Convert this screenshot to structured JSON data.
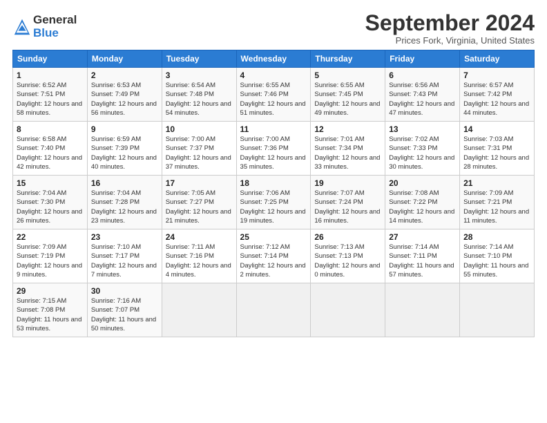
{
  "header": {
    "logo_general": "General",
    "logo_blue": "Blue",
    "title": "September 2024",
    "location": "Prices Fork, Virginia, United States"
  },
  "columns": [
    "Sunday",
    "Monday",
    "Tuesday",
    "Wednesday",
    "Thursday",
    "Friday",
    "Saturday"
  ],
  "weeks": [
    [
      {
        "day": "1",
        "sunrise": "Sunrise: 6:52 AM",
        "sunset": "Sunset: 7:51 PM",
        "daylight": "Daylight: 12 hours and 58 minutes."
      },
      {
        "day": "2",
        "sunrise": "Sunrise: 6:53 AM",
        "sunset": "Sunset: 7:49 PM",
        "daylight": "Daylight: 12 hours and 56 minutes."
      },
      {
        "day": "3",
        "sunrise": "Sunrise: 6:54 AM",
        "sunset": "Sunset: 7:48 PM",
        "daylight": "Daylight: 12 hours and 54 minutes."
      },
      {
        "day": "4",
        "sunrise": "Sunrise: 6:55 AM",
        "sunset": "Sunset: 7:46 PM",
        "daylight": "Daylight: 12 hours and 51 minutes."
      },
      {
        "day": "5",
        "sunrise": "Sunrise: 6:55 AM",
        "sunset": "Sunset: 7:45 PM",
        "daylight": "Daylight: 12 hours and 49 minutes."
      },
      {
        "day": "6",
        "sunrise": "Sunrise: 6:56 AM",
        "sunset": "Sunset: 7:43 PM",
        "daylight": "Daylight: 12 hours and 47 minutes."
      },
      {
        "day": "7",
        "sunrise": "Sunrise: 6:57 AM",
        "sunset": "Sunset: 7:42 PM",
        "daylight": "Daylight: 12 hours and 44 minutes."
      }
    ],
    [
      {
        "day": "8",
        "sunrise": "Sunrise: 6:58 AM",
        "sunset": "Sunset: 7:40 PM",
        "daylight": "Daylight: 12 hours and 42 minutes."
      },
      {
        "day": "9",
        "sunrise": "Sunrise: 6:59 AM",
        "sunset": "Sunset: 7:39 PM",
        "daylight": "Daylight: 12 hours and 40 minutes."
      },
      {
        "day": "10",
        "sunrise": "Sunrise: 7:00 AM",
        "sunset": "Sunset: 7:37 PM",
        "daylight": "Daylight: 12 hours and 37 minutes."
      },
      {
        "day": "11",
        "sunrise": "Sunrise: 7:00 AM",
        "sunset": "Sunset: 7:36 PM",
        "daylight": "Daylight: 12 hours and 35 minutes."
      },
      {
        "day": "12",
        "sunrise": "Sunrise: 7:01 AM",
        "sunset": "Sunset: 7:34 PM",
        "daylight": "Daylight: 12 hours and 33 minutes."
      },
      {
        "day": "13",
        "sunrise": "Sunrise: 7:02 AM",
        "sunset": "Sunset: 7:33 PM",
        "daylight": "Daylight: 12 hours and 30 minutes."
      },
      {
        "day": "14",
        "sunrise": "Sunrise: 7:03 AM",
        "sunset": "Sunset: 7:31 PM",
        "daylight": "Daylight: 12 hours and 28 minutes."
      }
    ],
    [
      {
        "day": "15",
        "sunrise": "Sunrise: 7:04 AM",
        "sunset": "Sunset: 7:30 PM",
        "daylight": "Daylight: 12 hours and 26 minutes."
      },
      {
        "day": "16",
        "sunrise": "Sunrise: 7:04 AM",
        "sunset": "Sunset: 7:28 PM",
        "daylight": "Daylight: 12 hours and 23 minutes."
      },
      {
        "day": "17",
        "sunrise": "Sunrise: 7:05 AM",
        "sunset": "Sunset: 7:27 PM",
        "daylight": "Daylight: 12 hours and 21 minutes."
      },
      {
        "day": "18",
        "sunrise": "Sunrise: 7:06 AM",
        "sunset": "Sunset: 7:25 PM",
        "daylight": "Daylight: 12 hours and 19 minutes."
      },
      {
        "day": "19",
        "sunrise": "Sunrise: 7:07 AM",
        "sunset": "Sunset: 7:24 PM",
        "daylight": "Daylight: 12 hours and 16 minutes."
      },
      {
        "day": "20",
        "sunrise": "Sunrise: 7:08 AM",
        "sunset": "Sunset: 7:22 PM",
        "daylight": "Daylight: 12 hours and 14 minutes."
      },
      {
        "day": "21",
        "sunrise": "Sunrise: 7:09 AM",
        "sunset": "Sunset: 7:21 PM",
        "daylight": "Daylight: 12 hours and 11 minutes."
      }
    ],
    [
      {
        "day": "22",
        "sunrise": "Sunrise: 7:09 AM",
        "sunset": "Sunset: 7:19 PM",
        "daylight": "Daylight: 12 hours and 9 minutes."
      },
      {
        "day": "23",
        "sunrise": "Sunrise: 7:10 AM",
        "sunset": "Sunset: 7:17 PM",
        "daylight": "Daylight: 12 hours and 7 minutes."
      },
      {
        "day": "24",
        "sunrise": "Sunrise: 7:11 AM",
        "sunset": "Sunset: 7:16 PM",
        "daylight": "Daylight: 12 hours and 4 minutes."
      },
      {
        "day": "25",
        "sunrise": "Sunrise: 7:12 AM",
        "sunset": "Sunset: 7:14 PM",
        "daylight": "Daylight: 12 hours and 2 minutes."
      },
      {
        "day": "26",
        "sunrise": "Sunrise: 7:13 AM",
        "sunset": "Sunset: 7:13 PM",
        "daylight": "Daylight: 12 hours and 0 minutes."
      },
      {
        "day": "27",
        "sunrise": "Sunrise: 7:14 AM",
        "sunset": "Sunset: 7:11 PM",
        "daylight": "Daylight: 11 hours and 57 minutes."
      },
      {
        "day": "28",
        "sunrise": "Sunrise: 7:14 AM",
        "sunset": "Sunset: 7:10 PM",
        "daylight": "Daylight: 11 hours and 55 minutes."
      }
    ],
    [
      {
        "day": "29",
        "sunrise": "Sunrise: 7:15 AM",
        "sunset": "Sunset: 7:08 PM",
        "daylight": "Daylight: 11 hours and 53 minutes."
      },
      {
        "day": "30",
        "sunrise": "Sunrise: 7:16 AM",
        "sunset": "Sunset: 7:07 PM",
        "daylight": "Daylight: 11 hours and 50 minutes."
      },
      null,
      null,
      null,
      null,
      null
    ]
  ]
}
